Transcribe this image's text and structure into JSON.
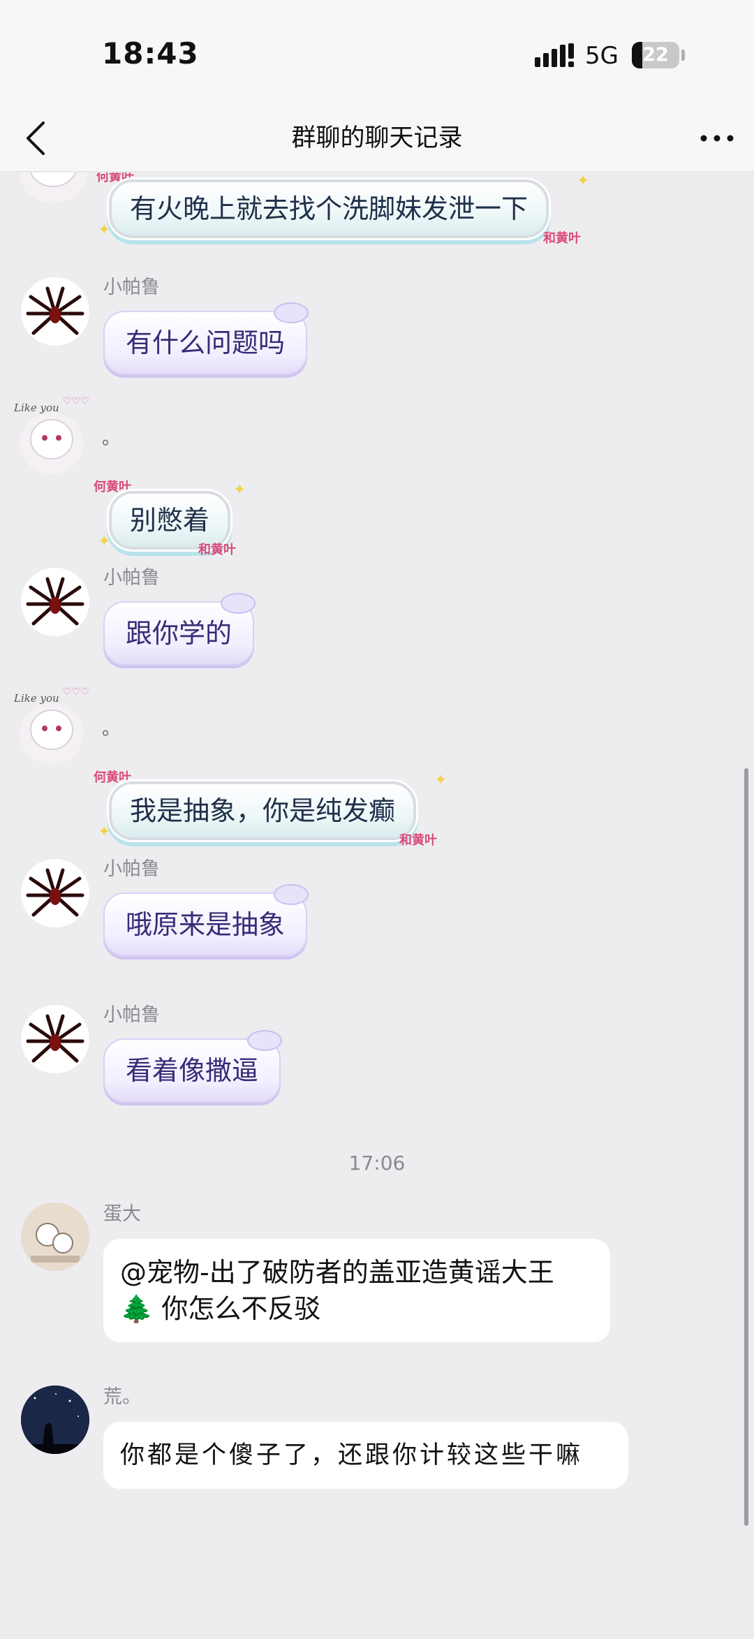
{
  "status_bar": {
    "time": "18:43",
    "network": "5G",
    "battery_level": "22",
    "battery_percent": 22,
    "icons": [
      "signal-bars-icon",
      "battery-icon"
    ]
  },
  "nav": {
    "title": "群聊的聊天记录",
    "back_icon": "chevron-left-icon",
    "more_icon": "more-dots-icon"
  },
  "messages": [
    {
      "kind": "green",
      "text": "有火晚上就去找个洗脚妹发泄一下",
      "tag": "和黄叶",
      "tag2": "何黄叶"
    },
    {
      "kind": "purple",
      "sender": "小帕鲁",
      "text": "有什么问题吗"
    },
    {
      "kind": "green",
      "sender": "。",
      "text": "别憋着",
      "tag": "和黄叶",
      "tag2": "何黄叶",
      "deco_text": "Like you"
    },
    {
      "kind": "purple",
      "sender": "小帕鲁",
      "text": "跟你学的"
    },
    {
      "kind": "green",
      "sender": "。",
      "text": "我是抽象，你是纯发癫",
      "tag": "和黄叶",
      "tag2": "何黄叶",
      "deco_text": "Like you"
    },
    {
      "kind": "purple",
      "sender": "小帕鲁",
      "text": "哦原来是抽象"
    },
    {
      "kind": "purple",
      "sender": "小帕鲁",
      "text": "看着像撒逼"
    },
    {
      "kind": "white",
      "sender": "蛋大",
      "line1": "@宠物-出了破防者的盖亚造黄谣大王",
      "line2": "🌲 你怎么不反驳"
    },
    {
      "kind": "white",
      "sender": "荒。",
      "text": "你都是个傻子了，还跟你计较这些干嘛"
    }
  ],
  "time_divider": "17:06",
  "colors": {
    "background": "#ededf0",
    "purple_text": "#3a2a78",
    "sender_gray": "#8a8a8e"
  }
}
